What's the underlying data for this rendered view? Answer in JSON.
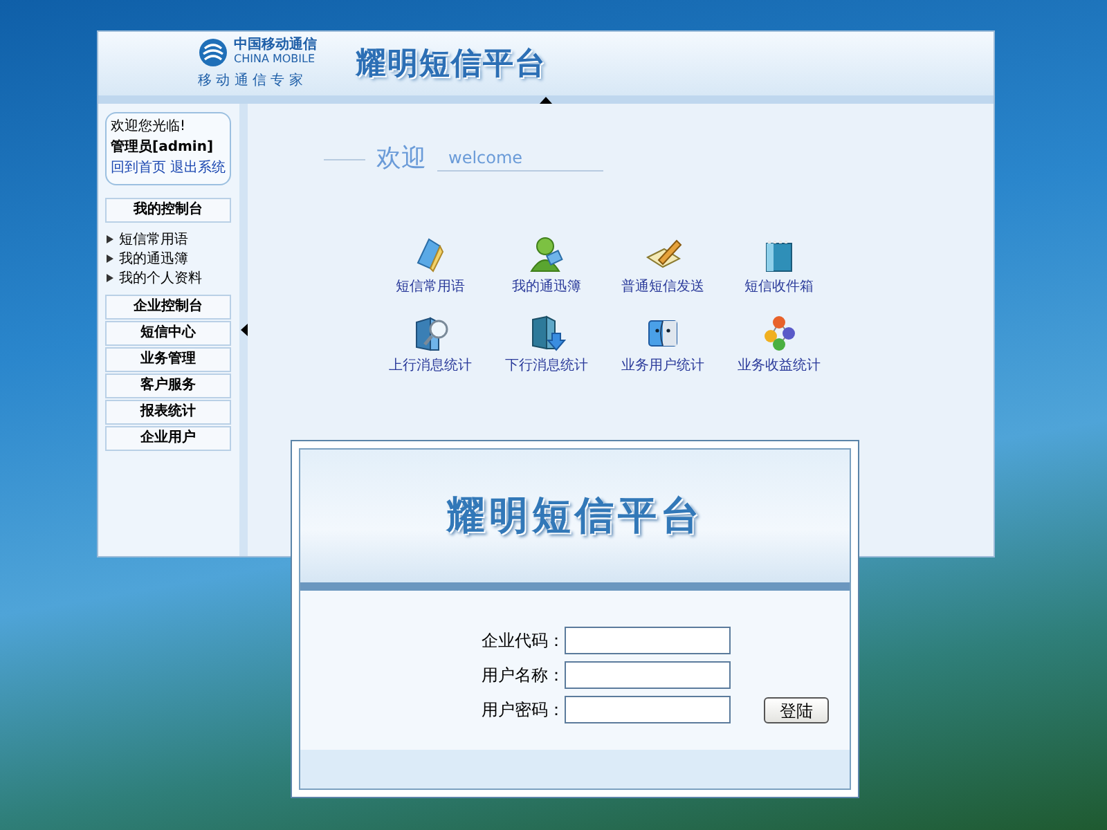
{
  "admin_window": {
    "logo": {
      "name_cn": "中国移动通信",
      "name_en": "CHINA MOBILE",
      "slogan": "移 动 通 信 专 家"
    },
    "title": "耀明短信平台",
    "sidebar": {
      "greeting": "欢迎您光临!",
      "user": "管理员[admin]",
      "links": [
        "回到首页",
        "退出系统"
      ],
      "menu": [
        {
          "label": "我的控制台",
          "children": [
            {
              "label": "短信常用语"
            },
            {
              "label": "我的通迅簿"
            },
            {
              "label": "我的个人资料"
            }
          ]
        },
        {
          "label": "企业控制台"
        },
        {
          "label": "短信中心"
        },
        {
          "label": "业务管理"
        },
        {
          "label": "客户服务"
        },
        {
          "label": "报表统计"
        },
        {
          "label": "企业用户"
        }
      ]
    },
    "welcome": {
      "title": "欢迎",
      "subtitle": "welcome"
    },
    "shortcuts": [
      {
        "label": "短信常用语",
        "kind": "book"
      },
      {
        "label": "我的通迅簿",
        "kind": "person"
      },
      {
        "label": "普通短信发送",
        "kind": "pencil"
      },
      {
        "label": "短信收件箱",
        "kind": "box"
      },
      {
        "label": "上行消息统计",
        "kind": "magnifier"
      },
      {
        "label": "下行消息统计",
        "kind": "arrow"
      },
      {
        "label": "业务用户统计",
        "kind": "face"
      },
      {
        "label": "业务收益统计",
        "kind": "balls"
      }
    ]
  },
  "login_window": {
    "title": "耀明短信平台",
    "fields": [
      {
        "label": "企业代码："
      },
      {
        "label": "用户名称："
      },
      {
        "label": "用户密码："
      }
    ],
    "button": "登陆"
  }
}
